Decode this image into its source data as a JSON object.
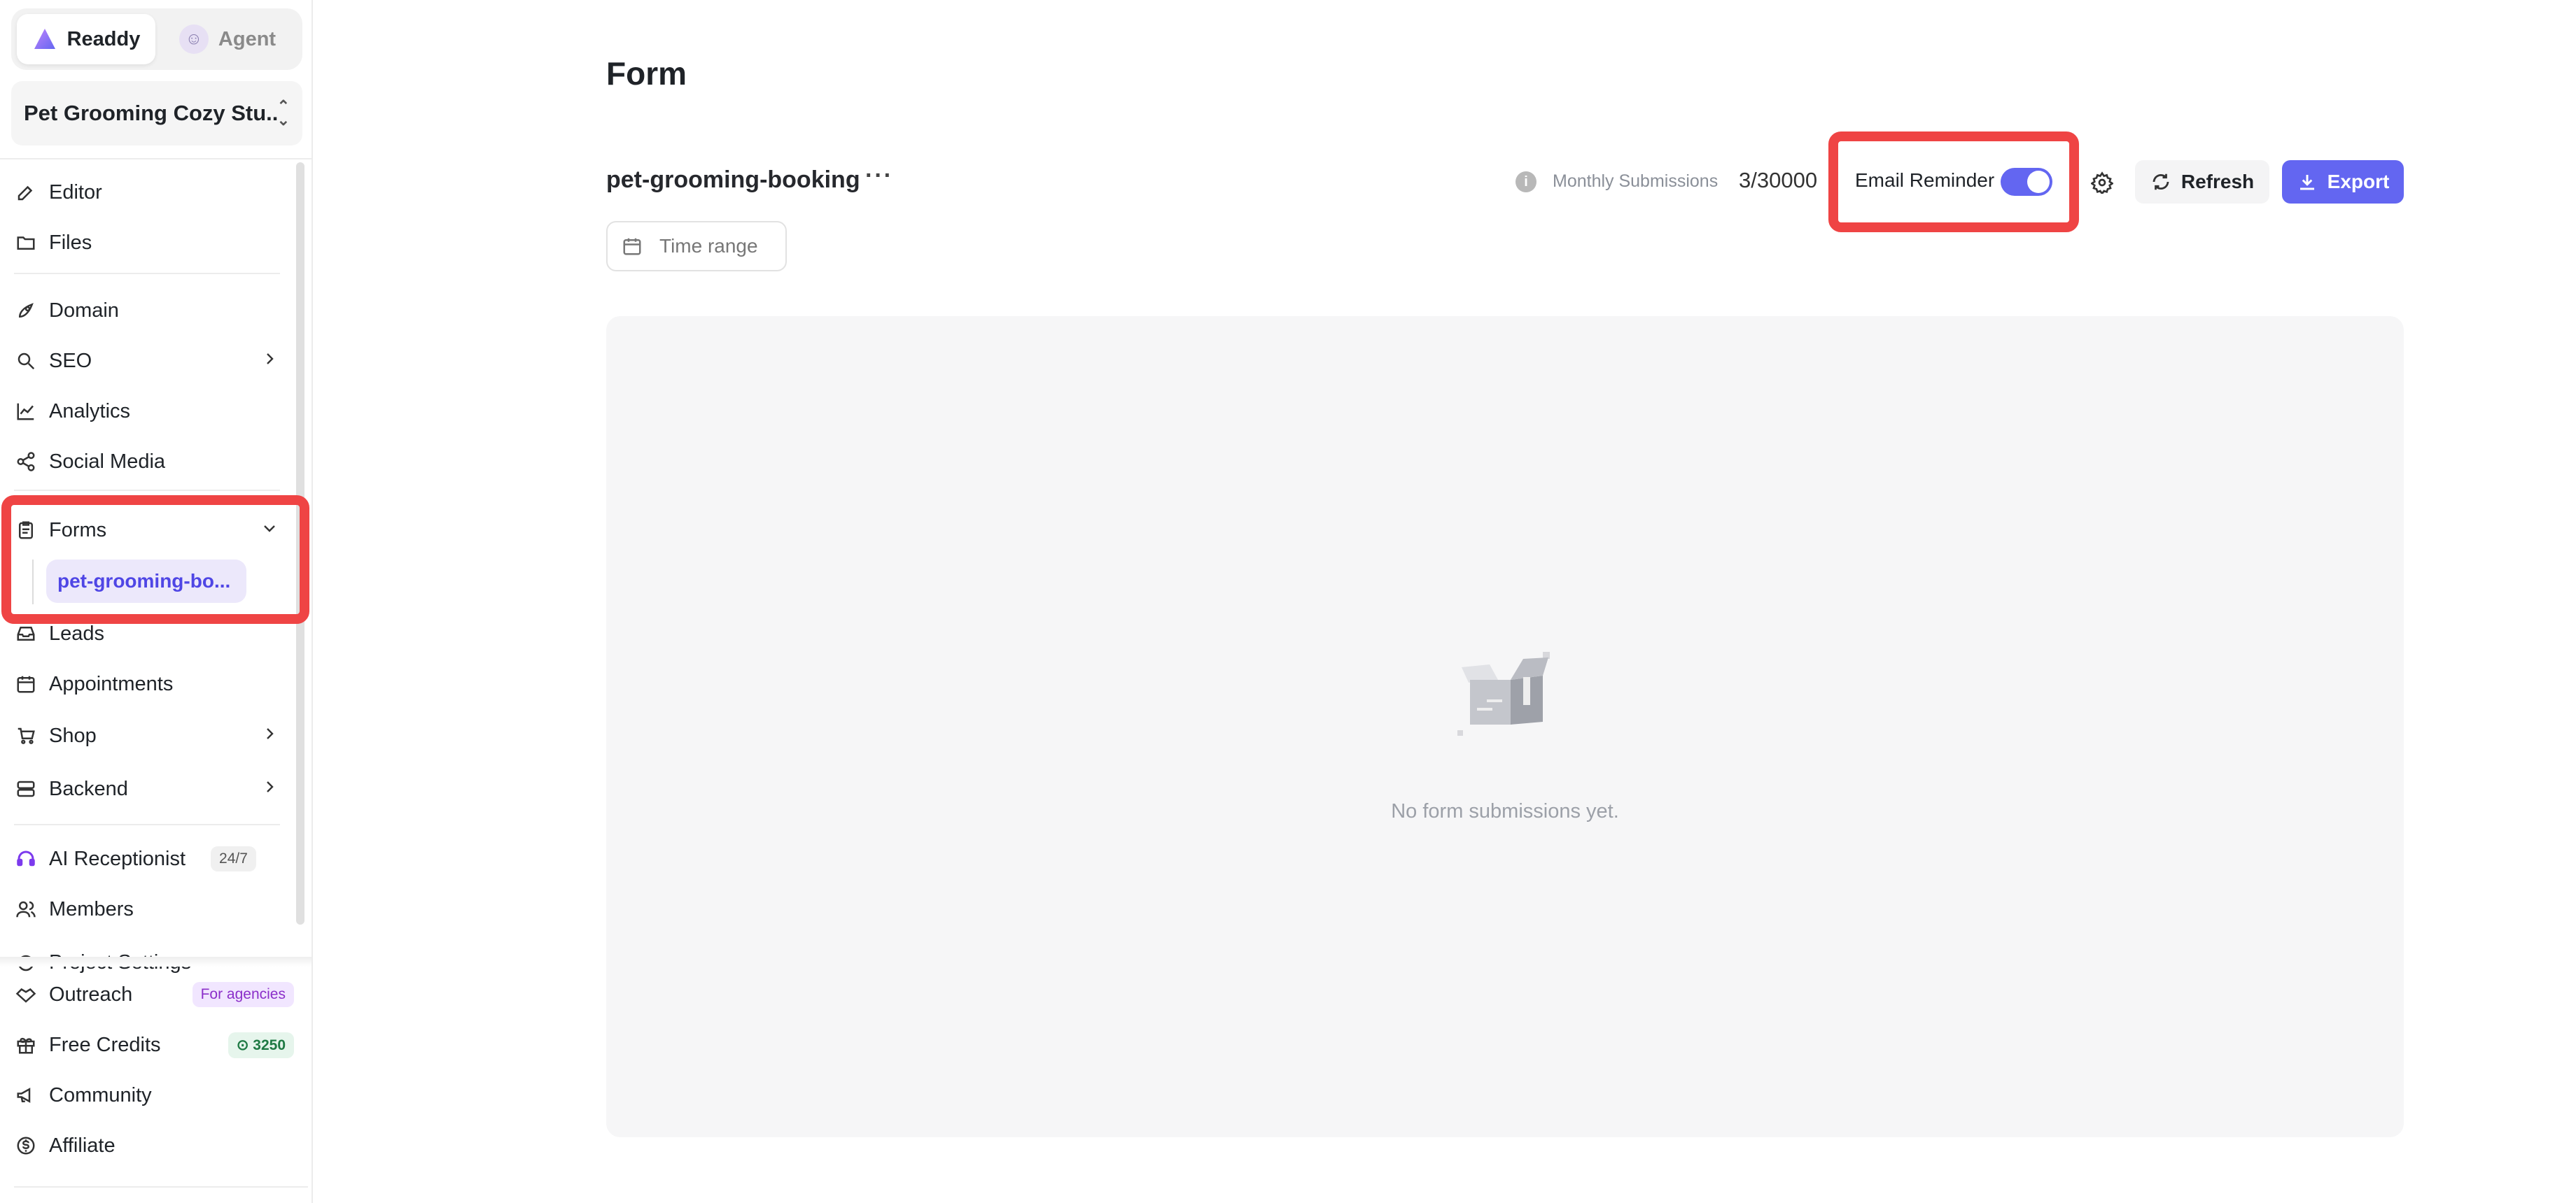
{
  "switcher": {
    "readdy": "Readdy",
    "agent": "Agent"
  },
  "project": {
    "name": "Pet Grooming Cozy Stu..."
  },
  "nav": {
    "editor": "Editor",
    "files": "Files",
    "domain": "Domain",
    "seo": "SEO",
    "analytics": "Analytics",
    "social_media": "Social Media",
    "forms": "Forms",
    "forms_sub": "pet-grooming-bo...",
    "leads": "Leads",
    "appointments": "Appointments",
    "shop": "Shop",
    "backend": "Backend",
    "ai_receptionist": "AI Receptionist",
    "ai_badge": "24/7",
    "members": "Members",
    "project_settings": "Project Settings"
  },
  "bottom_nav": {
    "outreach": "Outreach",
    "outreach_badge": "For agencies",
    "free_credits": "Free Credits",
    "credits_badge": "3250",
    "community": "Community",
    "affiliate": "Affiliate"
  },
  "main": {
    "title": "Form",
    "form_name": "pet-grooming-booking",
    "more": "···",
    "monthly_label": "Monthly Submissions",
    "monthly_count": "3/30000",
    "email_reminder": "Email Reminder",
    "email_reminder_on": true,
    "refresh": "Refresh",
    "export": "Export",
    "time_range": "Time range",
    "empty": "No form submissions yet."
  },
  "colors": {
    "accent": "#6366f1",
    "highlight": "#ef4444"
  }
}
